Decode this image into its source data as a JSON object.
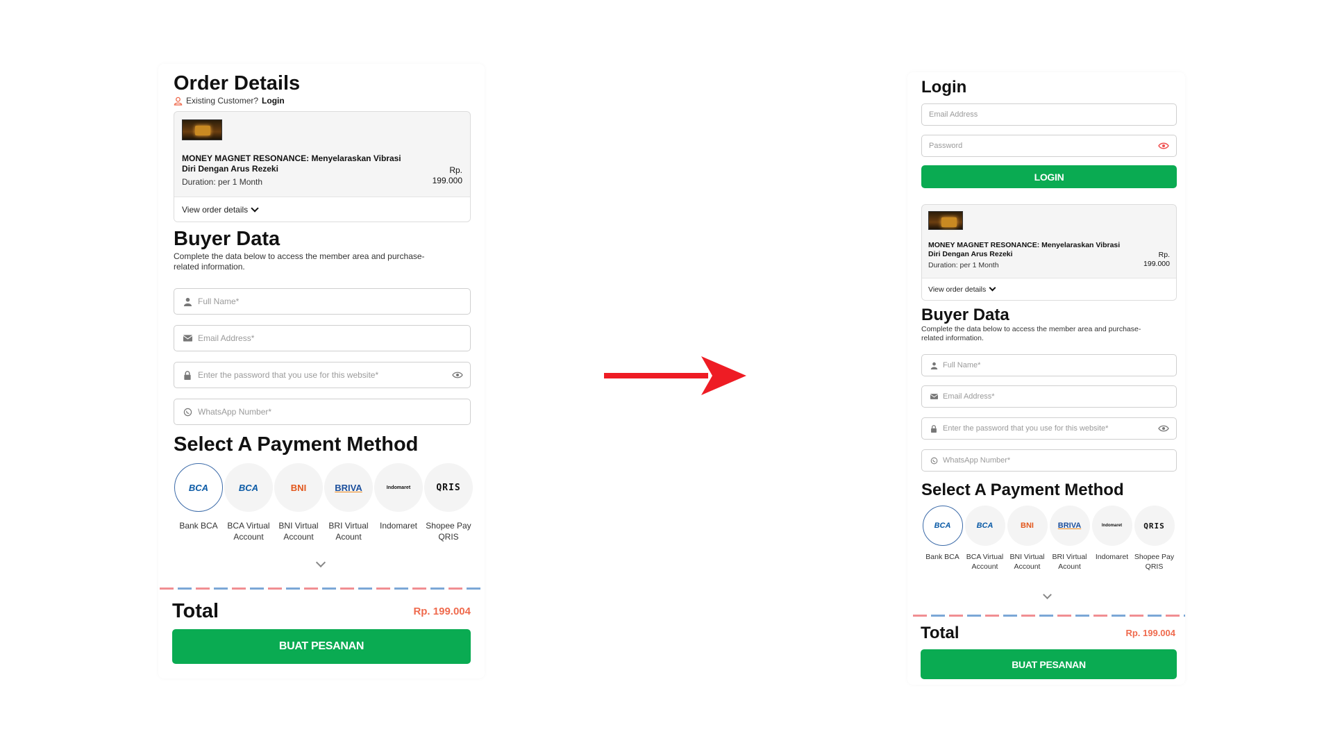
{
  "left": {
    "title": "Order Details",
    "existing_text": "Existing Customer?",
    "existing_link": "Login",
    "product": {
      "name_line1": "MONEY MAGNET RESONANCE: Menyelaraskan Vibrasi",
      "name_line2": "Diri Dengan Arus Rezeki",
      "duration": "Duration: per 1 Month",
      "price_line1": "Rp.",
      "price_line2": "199.000",
      "view_details": "View order details"
    },
    "buyer": {
      "title": "Buyer Data",
      "sub_line1": "Complete the data below to access the member area and purchase-",
      "sub_line2": "related information."
    },
    "fields": {
      "full_name": "Full Name*",
      "email": "Email Address*",
      "password": "Enter the password that you use for this website*",
      "whatsapp": "WhatsApp Number*"
    },
    "payment_title": "Select A Payment Method",
    "payments": [
      {
        "logo": "BCA",
        "l1": "Bank BCA",
        "l2": ""
      },
      {
        "logo": "BCA",
        "l1": "BCA Virtual",
        "l2": "Account"
      },
      {
        "logo": "BNI",
        "l1": "BNI Virtual",
        "l2": "Account"
      },
      {
        "logo": "BRIVA",
        "l1": "BRI Virtual",
        "l2": "Acount"
      },
      {
        "logo": "Indomaret",
        "l1": "Indomaret",
        "l2": ""
      },
      {
        "logo": "QRIS",
        "l1": "Shopee Pay",
        "l2": "QRIS"
      }
    ],
    "total_label": "Total",
    "total_value": "Rp. 199.004",
    "submit": "BUAT PESANAN"
  },
  "right": {
    "login_title": "Login",
    "email_placeholder": "Email Address",
    "password_placeholder": "Password",
    "login_button": "LOGIN",
    "product": {
      "name_line1": "MONEY MAGNET RESONANCE: Menyelaraskan Vibrasi",
      "name_line2": "Diri Dengan Arus Rezeki",
      "duration": "Duration: per 1 Month",
      "price_line1": "Rp.",
      "price_line2": "199.000",
      "view_details": "View order details"
    },
    "buyer": {
      "title": "Buyer Data",
      "sub_line1": "Complete the data below to access the member area and purchase-",
      "sub_line2": "related information."
    },
    "fields": {
      "full_name": "Full Name*",
      "email": "Email Address*",
      "password": "Enter the password that you use for this website*",
      "whatsapp": "WhatsApp Number*"
    },
    "payment_title": "Select A Payment Method",
    "payments": [
      {
        "logo": "BCA",
        "l1": "Bank BCA",
        "l2": ""
      },
      {
        "logo": "BCA",
        "l1": "BCA Virtual",
        "l2": "Account"
      },
      {
        "logo": "BNI",
        "l1": "BNI Virtual",
        "l2": "Account"
      },
      {
        "logo": "BRIVA",
        "l1": "BRI Virtual",
        "l2": "Acount"
      },
      {
        "logo": "Indomaret",
        "l1": "Indomaret",
        "l2": ""
      },
      {
        "logo": "QRIS",
        "l1": "Shopee Pay",
        "l2": "QRIS"
      }
    ],
    "total_label": "Total",
    "total_value": "Rp. 199.004",
    "submit": "BUAT PESANAN"
  },
  "colors": {
    "accent_green": "#0aab52",
    "total_orange": "#ef6a4d",
    "arrow_red": "#ee1c24",
    "selected_border": "#3b6aa8"
  }
}
